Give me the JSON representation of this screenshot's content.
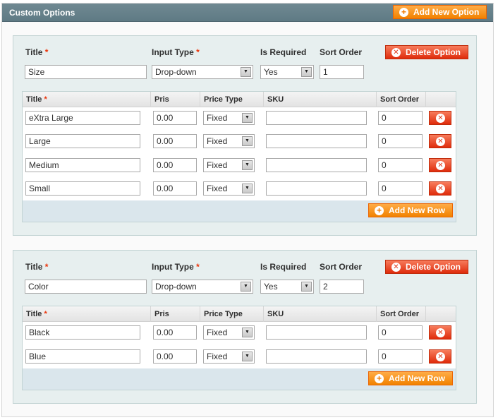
{
  "header": {
    "title": "Custom Options",
    "add_option_label": "Add New Option"
  },
  "labels": {
    "title": "Title",
    "required_mark": "*",
    "input_type": "Input Type",
    "is_required": "Is Required",
    "sort_order": "Sort Order",
    "delete_option": "Delete Option",
    "add_new_row": "Add New Row"
  },
  "columns": {
    "title": "Title",
    "price": "Pris",
    "price_type": "Price Type",
    "sku": "SKU",
    "sort_order": "Sort Order"
  },
  "options": [
    {
      "title": "Size",
      "input_type": "Drop-down",
      "is_required": "Yes",
      "sort_order": "1",
      "rows": [
        {
          "title": "eXtra Large",
          "price": "0.00",
          "price_type": "Fixed",
          "sku": "",
          "sort_order": "0"
        },
        {
          "title": "Large",
          "price": "0.00",
          "price_type": "Fixed",
          "sku": "",
          "sort_order": "0"
        },
        {
          "title": "Medium",
          "price": "0.00",
          "price_type": "Fixed",
          "sku": "",
          "sort_order": "0"
        },
        {
          "title": "Small",
          "price": "0.00",
          "price_type": "Fixed",
          "sku": "",
          "sort_order": "0"
        }
      ]
    },
    {
      "title": "Color",
      "input_type": "Drop-down",
      "is_required": "Yes",
      "sort_order": "2",
      "rows": [
        {
          "title": "Black",
          "price": "0.00",
          "price_type": "Fixed",
          "sku": "",
          "sort_order": "0"
        },
        {
          "title": "Blue",
          "price": "0.00",
          "price_type": "Fixed",
          "sku": "",
          "sort_order": "0"
        }
      ]
    }
  ],
  "icons": {
    "add": "plus-circle-icon",
    "delete": "x-circle-icon",
    "dropdown": "dropdown-arrow-icon"
  },
  "colors": {
    "header_bg": "#6f8992",
    "button_orange": "#f18200",
    "button_red": "#df2c0c",
    "required": "#eb340a",
    "option_bg": "#e7efef"
  }
}
